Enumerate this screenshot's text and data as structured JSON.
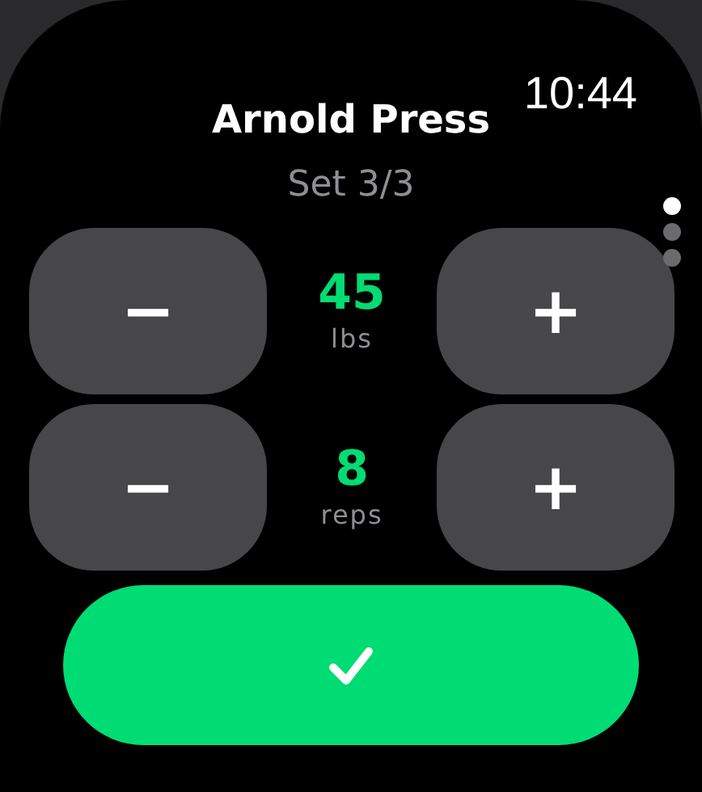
{
  "status_bar": {
    "time": "10:44"
  },
  "exercise": {
    "title": "Arnold Press",
    "set": "Set 3/3"
  },
  "steppers": [
    {
      "value": "45",
      "unit": "lbs",
      "decrement": "−",
      "increment": "+"
    },
    {
      "value": "8",
      "unit": "reps",
      "decrement": "−",
      "increment": "+"
    }
  ],
  "confirm_button": {
    "kind": "checkmark"
  },
  "pages": [
    {
      "selected": true
    },
    {
      "selected": false
    },
    {
      "selected": false
    }
  ]
}
